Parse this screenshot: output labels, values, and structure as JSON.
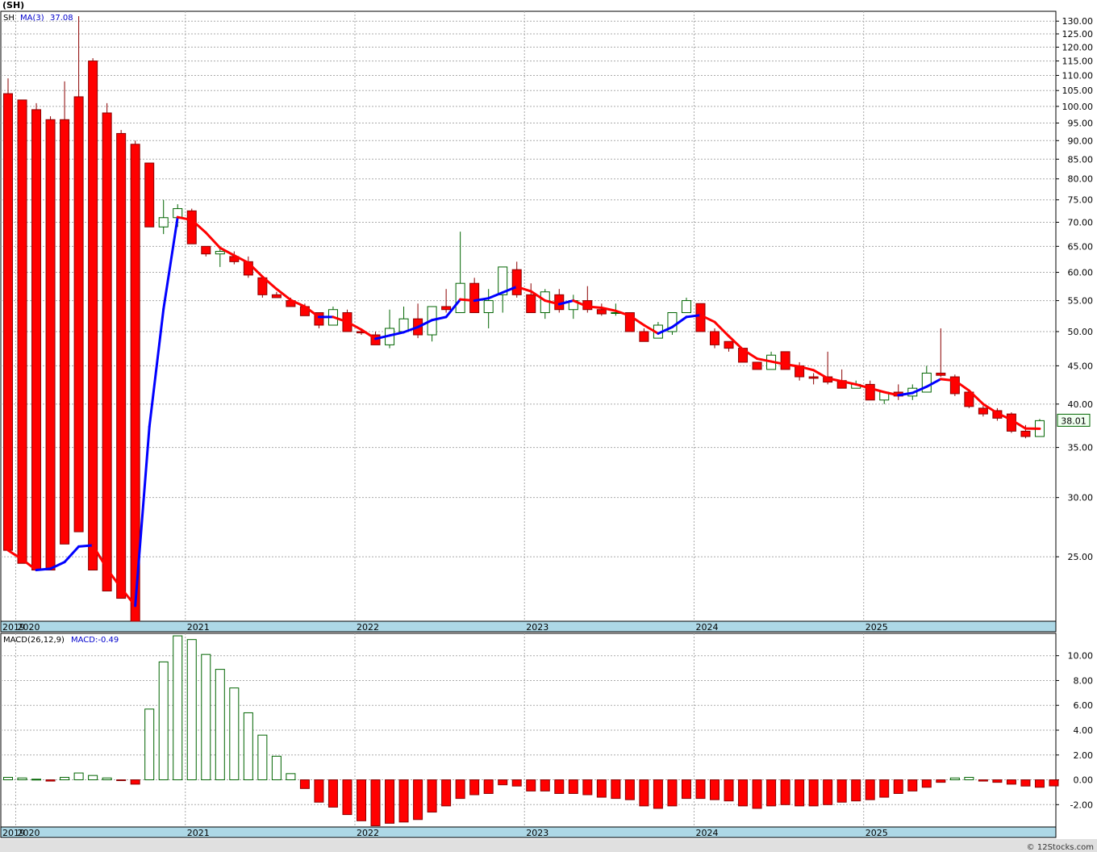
{
  "title": "(SH)",
  "watermark": "© 12Stocks.com",
  "chart_data": [
    {
      "type": "candlestick",
      "interval": "monthly",
      "symbol_label": "SH",
      "ma_label": "MA(3)",
      "ma_value": "37.08",
      "last_price": "38.01",
      "y_scale": "log",
      "ylim": [
        20.5,
        134
      ],
      "y_ticks": [
        "130.00",
        "125.00",
        "120.00",
        "115.00",
        "110.00",
        "105.00",
        "100.00",
        "95.00",
        "90.00",
        "85.00",
        "80.00",
        "75.00",
        "70.00",
        "65.00",
        "60.00",
        "55.00",
        "50.00",
        "45.00",
        "40.00",
        "35.00",
        "30.00",
        "25.00"
      ],
      "x_labels": [
        "2019",
        "2020",
        "2021",
        "2022",
        "2023",
        "2024",
        "2025"
      ],
      "grid": true,
      "colors": {
        "up": "#ffffff",
        "up_border": "#006400",
        "down": "#ff0000",
        "down_border": "#8b0000",
        "ma_up": "#0000ff",
        "ma_down": "#ff0000"
      },
      "candles": [
        {
          "o": 104,
          "h": 109,
          "l": 25.5,
          "c": 25.5
        },
        {
          "o": 102,
          "h": 102,
          "l": 24.5,
          "c": 24.5
        },
        {
          "o": 99,
          "h": 101,
          "l": 24,
          "c": 24
        },
        {
          "o": 96,
          "h": 97,
          "l": 24,
          "c": 24
        },
        {
          "o": 96,
          "h": 108,
          "l": 26,
          "c": 26
        },
        {
          "o": 103,
          "h": 132,
          "l": 27,
          "c": 27
        },
        {
          "o": 115,
          "h": 116,
          "l": 24,
          "c": 24
        },
        {
          "o": 98,
          "h": 101,
          "l": 22.5,
          "c": 22.5
        },
        {
          "o": 92,
          "h": 93,
          "l": 22,
          "c": 22
        },
        {
          "o": 89,
          "h": 90,
          "l": 20.5,
          "c": 20.5
        },
        {
          "o": 84,
          "h": 84,
          "l": 69,
          "c": 69
        },
        {
          "o": 69,
          "h": 75,
          "l": 67.5,
          "c": 71
        },
        {
          "o": 71,
          "h": 74,
          "l": 69,
          "c": 73
        },
        {
          "o": 72.5,
          "h": 73,
          "l": 65.5,
          "c": 65.5
        },
        {
          "o": 65,
          "h": 65,
          "l": 63,
          "c": 63.5
        },
        {
          "o": 63.5,
          "h": 65,
          "l": 61,
          "c": 64
        },
        {
          "o": 63,
          "h": 64,
          "l": 61.5,
          "c": 62
        },
        {
          "o": 62,
          "h": 63,
          "l": 59,
          "c": 59.5
        },
        {
          "o": 59,
          "h": 59,
          "l": 55.5,
          "c": 56
        },
        {
          "o": 56,
          "h": 56.5,
          "l": 55.5,
          "c": 55.5
        },
        {
          "o": 55,
          "h": 55.5,
          "l": 54,
          "c": 54
        },
        {
          "o": 54,
          "h": 54.5,
          "l": 52.5,
          "c": 52.5
        },
        {
          "o": 53,
          "h": 53,
          "l": 50.5,
          "c": 51
        },
        {
          "o": 51,
          "h": 54,
          "l": 51,
          "c": 53.5
        },
        {
          "o": 53,
          "h": 53.5,
          "l": 50,
          "c": 50
        },
        {
          "o": 50,
          "h": 50.5,
          "l": 49.5,
          "c": 49.8
        },
        {
          "o": 49.5,
          "h": 50,
          "l": 48,
          "c": 48
        },
        {
          "o": 48,
          "h": 53.5,
          "l": 47.5,
          "c": 50.5
        },
        {
          "o": 50,
          "h": 54,
          "l": 50,
          "c": 52
        },
        {
          "o": 52,
          "h": 54.5,
          "l": 49,
          "c": 49.5
        },
        {
          "o": 49.5,
          "h": 54,
          "l": 48.5,
          "c": 54
        },
        {
          "o": 54,
          "h": 57,
          "l": 53,
          "c": 53.5
        },
        {
          "o": 53,
          "h": 68,
          "l": 53,
          "c": 58
        },
        {
          "o": 58,
          "h": 59,
          "l": 53,
          "c": 53
        },
        {
          "o": 53,
          "h": 57,
          "l": 50.5,
          "c": 55
        },
        {
          "o": 56,
          "h": 61,
          "l": 53,
          "c": 61
        },
        {
          "o": 60.5,
          "h": 62,
          "l": 55.5,
          "c": 56
        },
        {
          "o": 56,
          "h": 58,
          "l": 53,
          "c": 53
        },
        {
          "o": 53,
          "h": 57,
          "l": 52,
          "c": 56.5
        },
        {
          "o": 56,
          "h": 57,
          "l": 53,
          "c": 53.5
        },
        {
          "o": 53.5,
          "h": 56,
          "l": 52,
          "c": 55
        },
        {
          "o": 55,
          "h": 57.5,
          "l": 53,
          "c": 53.5
        },
        {
          "o": 53.5,
          "h": 54.5,
          "l": 52.5,
          "c": 52.8
        },
        {
          "o": 53,
          "h": 54.5,
          "l": 52.5,
          "c": 53
        },
        {
          "o": 53,
          "h": 53,
          "l": 50,
          "c": 50
        },
        {
          "o": 50,
          "h": 50.5,
          "l": 48.5,
          "c": 48.5
        },
        {
          "o": 49,
          "h": 51.5,
          "l": 49,
          "c": 51
        },
        {
          "o": 50,
          "h": 53,
          "l": 49.5,
          "c": 53
        },
        {
          "o": 53,
          "h": 55.5,
          "l": 53,
          "c": 55
        },
        {
          "o": 54.5,
          "h": 54.5,
          "l": 50,
          "c": 50
        },
        {
          "o": 50,
          "h": 50.5,
          "l": 47.5,
          "c": 48
        },
        {
          "o": 48.5,
          "h": 48.5,
          "l": 47,
          "c": 47.5
        },
        {
          "o": 47.5,
          "h": 47.5,
          "l": 45.5,
          "c": 45.5
        },
        {
          "o": 45.5,
          "h": 45.5,
          "l": 44.5,
          "c": 44.5
        },
        {
          "o": 44.5,
          "h": 47,
          "l": 44.5,
          "c": 46.5
        },
        {
          "o": 47,
          "h": 47,
          "l": 44.5,
          "c": 44.5
        },
        {
          "o": 45,
          "h": 45.5,
          "l": 43,
          "c": 43.5
        },
        {
          "o": 43.5,
          "h": 44,
          "l": 42.5,
          "c": 43.3
        },
        {
          "o": 43.5,
          "h": 47,
          "l": 42.5,
          "c": 42.8
        },
        {
          "o": 43,
          "h": 44.5,
          "l": 42,
          "c": 42
        },
        {
          "o": 42,
          "h": 43,
          "l": 42,
          "c": 42.5
        },
        {
          "o": 42.5,
          "h": 43,
          "l": 40.5,
          "c": 40.5
        },
        {
          "o": 40.5,
          "h": 41.5,
          "l": 40,
          "c": 41.5
        },
        {
          "o": 41.5,
          "h": 42.5,
          "l": 40.5,
          "c": 41
        },
        {
          "o": 41,
          "h": 42.5,
          "l": 40.5,
          "c": 42
        },
        {
          "o": 41.5,
          "h": 45,
          "l": 41.5,
          "c": 44
        },
        {
          "o": 44,
          "h": 50.5,
          "l": 43.5,
          "c": 43.7
        },
        {
          "o": 43.5,
          "h": 43.8,
          "l": 41,
          "c": 41.3
        },
        {
          "o": 41.5,
          "h": 41.8,
          "l": 39.5,
          "c": 39.7
        },
        {
          "o": 39.5,
          "h": 39.8,
          "l": 38.5,
          "c": 38.8
        },
        {
          "o": 39.2,
          "h": 39.5,
          "l": 38,
          "c": 38.3
        },
        {
          "o": 38.8,
          "h": 39,
          "l": 36.6,
          "c": 36.8
        },
        {
          "o": 36.8,
          "h": 37.5,
          "l": 36,
          "c": 36.2
        },
        {
          "o": 36.2,
          "h": 38.2,
          "l": 36.2,
          "c": 38.01
        }
      ],
      "ma": [
        25.5,
        24.8,
        24,
        24.1,
        24.6,
        25.8,
        25.9,
        24.1,
        22.7,
        21.5,
        37.3,
        53.6,
        71.1,
        70.5,
        67.8,
        64.7,
        63.2,
        61.8,
        59.2,
        57,
        55.1,
        54,
        52.3,
        52.3,
        51.5,
        50.3,
        48.9,
        49.4,
        49.9,
        50.7,
        51.8,
        52.3,
        55.2,
        55,
        55.4,
        56.4,
        57.4,
        56.6,
        55,
        54.4,
        55,
        54,
        53.8,
        53.3,
        52.5,
        51,
        49.7,
        50.7,
        52.3,
        52.6,
        51.5,
        49.3,
        47.3,
        46,
        45.6,
        45.2,
        44.9,
        44.4,
        43.3,
        42.9,
        42.5,
        42,
        41.5,
        41.1,
        41.4,
        42.2,
        43.2,
        43,
        41.7,
        40,
        38.9,
        38.1,
        37.1,
        37.08
      ],
      "x_label_index": [
        0,
        1,
        13,
        25,
        37,
        49,
        61
      ]
    },
    {
      "type": "bar",
      "label": "MACD(26,12,9)",
      "value_label": "MACD:-0.49",
      "ylim": [
        -3.8,
        11.8
      ],
      "y_ticks": [
        "10.00",
        "8.00",
        "6.00",
        "4.00",
        "2.00",
        "0.00",
        "-2.00"
      ],
      "x_labels": [
        "2019",
        "2020",
        "2021",
        "2022",
        "2023",
        "2024",
        "2025"
      ],
      "colors": {
        "positive_border": "#006400",
        "positive_fill": "#ffffff",
        "negative": "#ff0000",
        "negative_border": "#8b0000"
      },
      "values": [
        0.2,
        0.15,
        0.05,
        -0.1,
        0.2,
        0.55,
        0.35,
        0.15,
        -0.05,
        -0.35,
        5.7,
        9.5,
        11.6,
        11.3,
        10.1,
        8.9,
        7.4,
        5.4,
        3.6,
        1.9,
        0.5,
        -0.7,
        -1.8,
        -2.2,
        -2.8,
        -3.3,
        -3.7,
        -3.5,
        -3.4,
        -3.2,
        -2.6,
        -2.1,
        -1.5,
        -1.2,
        -1.1,
        -0.4,
        -0.5,
        -0.9,
        -0.9,
        -1.1,
        -1.1,
        -1.2,
        -1.4,
        -1.5,
        -1.6,
        -2.1,
        -2.3,
        -2.1,
        -1.5,
        -1.5,
        -1.6,
        -1.7,
        -2.1,
        -2.3,
        -2.1,
        -2.0,
        -2.1,
        -2.1,
        -2.0,
        -1.8,
        -1.7,
        -1.6,
        -1.4,
        -1.1,
        -0.9,
        -0.6,
        -0.2,
        0.15,
        0.2,
        -0.1,
        -0.2,
        -0.35,
        -0.5,
        -0.6,
        -0.49
      ]
    }
  ]
}
